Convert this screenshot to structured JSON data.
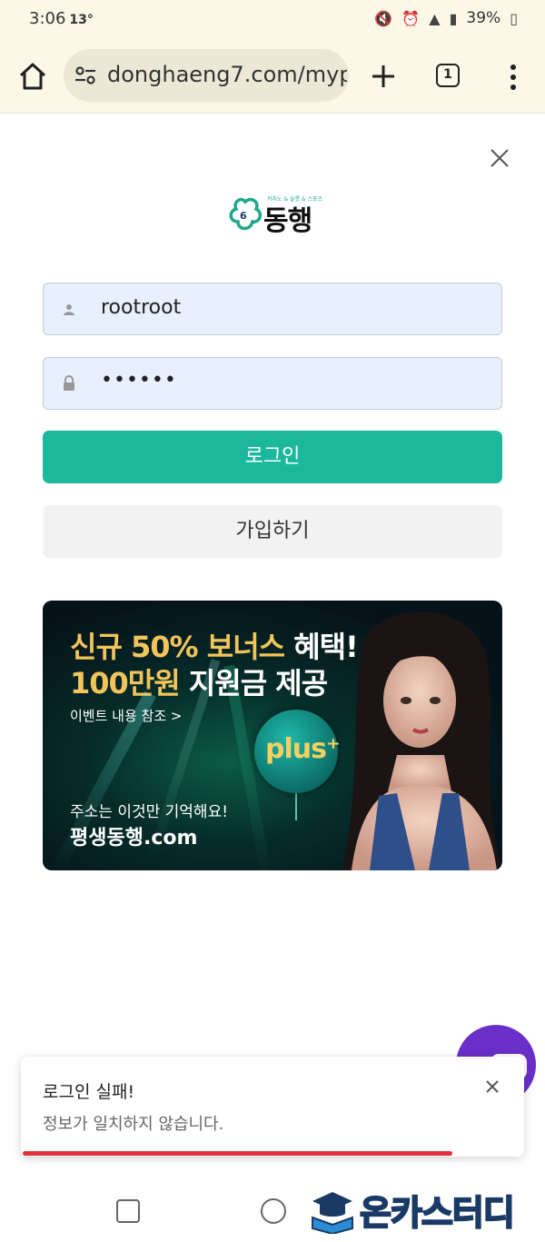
{
  "status_bar": {
    "time": "3:06",
    "temp": "13°",
    "battery": "39%"
  },
  "browser": {
    "url": "donghaeng7.com/myp",
    "tab_count": "1"
  },
  "logo": {
    "tagline": "카지노 & 슬롯 & 스포츠",
    "name": "동행"
  },
  "login": {
    "username": "rootroot",
    "password_masked": "••••••",
    "login_label": "로그인",
    "join_label": "가입하기"
  },
  "banner": {
    "line1_gold": "신규 50% 보너스",
    "line1_white": " 혜택!",
    "line2_gold": "100만원",
    "line2_white": " 지원금 제공",
    "event_link": "이벤트 내용 참조 >",
    "plus_text": "plus⁺",
    "address_note": "주소는 이것만 기억해요!",
    "address": "평생동행.com"
  },
  "toast": {
    "title": "로그인 실패!",
    "message": "정보가 일치하지 않습니다.",
    "progress": 0.86
  },
  "watermark": {
    "text": "온카스터디"
  }
}
